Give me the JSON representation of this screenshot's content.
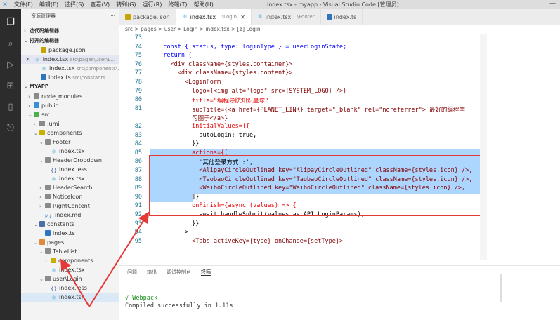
{
  "titlebar": {
    "menu": [
      "文件(F)",
      "编辑(E)",
      "选择(S)",
      "查看(V)",
      "转到(G)",
      "运行(R)",
      "终端(T)",
      "帮助(H)"
    ],
    "window_title": "index.tsx - myapp - Visual Studio Code [管理员]",
    "minimize": "—"
  },
  "sidebar": {
    "header": "资源管理器",
    "more": "···",
    "open_editors_title": "打开的编辑器",
    "group_title": "选代码编辑器",
    "open_editors": [
      {
        "name": "package.json",
        "path": ""
      },
      {
        "name": "index.tsx",
        "path": "src\\pages\\user\\L..."
      },
      {
        "name": "index.tsx",
        "path": "src\\components\\..."
      },
      {
        "name": "index.ts",
        "path": "src\\constants"
      }
    ],
    "project_title": "MYAPP",
    "tree": [
      {
        "label": "node_modules"
      },
      {
        "label": "public"
      },
      {
        "label": "src"
      },
      {
        "label": ".umi"
      },
      {
        "label": "components"
      },
      {
        "label": "Footer"
      },
      {
        "label": "index.tsx"
      },
      {
        "label": "HeaderDropdown"
      },
      {
        "label": "index.less"
      },
      {
        "label": "index.tsx"
      },
      {
        "label": "HeaderSearch"
      },
      {
        "label": "NoticeIcon"
      },
      {
        "label": "RightContent"
      },
      {
        "label": "index.md"
      },
      {
        "label": "constants"
      },
      {
        "label": "index.ts"
      },
      {
        "label": "pages"
      },
      {
        "label": "TableList"
      },
      {
        "label": "components"
      },
      {
        "label": "index.tsx"
      },
      {
        "label": "user\\Login"
      },
      {
        "label": "index.less"
      },
      {
        "label": "index.tsx"
      }
    ]
  },
  "tabs": [
    {
      "label": "package.json",
      "sub": ""
    },
    {
      "label": "index.tsx",
      "sub": "...\\Login",
      "close": "✕"
    },
    {
      "label": "index.tsx",
      "sub": "...\\Footer"
    },
    {
      "label": "index.ts",
      "sub": ""
    }
  ],
  "breadcrumb": "src > pages > user > Login > index.tsx > [ø] Login",
  "line_numbers": [
    "73",
    "74",
    "75",
    "76",
    "77",
    "78",
    "79",
    "80",
    "81",
    "",
    "82",
    "83",
    "84",
    "85",
    "86",
    "87",
    "88",
    "89",
    "90",
    "91",
    "92",
    "93",
    "94",
    "95"
  ],
  "code_lines": [
    "",
    "  const { status, type: loginType } = userLoginState;",
    "  return (",
    "    <div className={styles.container}>",
    "      <div className={styles.content}>",
    "        <LoginForm",
    "          logo={<img alt=\"logo\" src={SYSTEM_LOGO} />}",
    "          title=\"编程导航知识星球\"",
    "          subTitle={<a href={PLANET_LINK} target=\"_blank\" rel=\"noreferrer\"> 最好的编程学",
    "          习圈子</a>}",
    "          initialValues={{",
    "            autoLogin: true,",
    "          }}",
    "          actions={[",
    "            '其他登录方式 :',",
    "            <AlipayCircleOutlined key=\"AlipayCircleOutlined\" className={styles.icon} />,",
    "            <TaobaoCircleOutlined key=\"TaobaoCircleOutlined\" className={styles.icon} />,",
    "            <WeiboCircleOutlined key=\"WeiboCircleOutlined\" className={styles.icon} />,",
    "          ]}",
    "          onFinish={async (values) => {",
    "            await handleSubmit(values as API.LoginParams);",
    "          }}",
    "        >",
    "          <Tabs activeKey={type} onChange={setType}>"
  ],
  "panel": {
    "tabs": [
      "问题",
      "输出",
      "调试控制台",
      "终端"
    ],
    "terminal_line1": "√ Webpack",
    "terminal_line2": "  Compiled successfully in 1.11s"
  },
  "colors": {
    "accent": "#1a7fd4",
    "annotation": "#e53935",
    "selection": "#add6ff"
  }
}
